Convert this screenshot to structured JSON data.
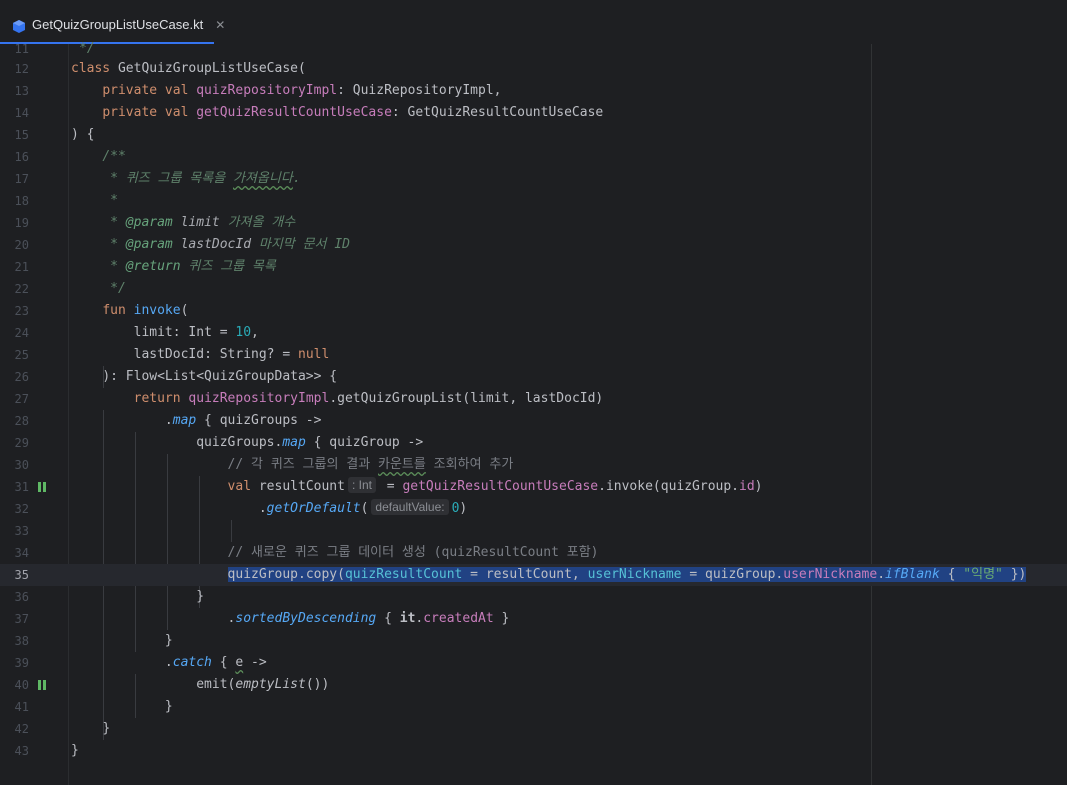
{
  "tab": {
    "filename": "GetQuizGroupListUseCase.kt",
    "icon": "kotlin-file-icon",
    "accent": "#3574f0"
  },
  "editor": {
    "current_line": "35",
    "line_numbers": [
      "11",
      "12",
      "13",
      "14",
      "15",
      "16",
      "17",
      "18",
      "19",
      "20",
      "21",
      "22",
      "23",
      "24",
      "25",
      "26",
      "27",
      "28",
      "29",
      "30",
      "31",
      "32",
      "33",
      "34",
      "35",
      "36",
      "37",
      "38",
      "39",
      "40",
      "41",
      "42",
      "43"
    ],
    "tokens": {
      "l11": "*/",
      "l12_kw": "class",
      "l12_name": "GetQuizGroupListUseCase(",
      "l13_kw": "private val",
      "l13_prop": "quizRepositoryImpl",
      "l13_type": ": QuizRepositoryImpl,",
      "l14_kw": "private val",
      "l14_prop": "getQuizResultCountUseCase",
      "l14_type": ": GetQuizResultCountUseCase",
      "l15": ") {",
      "l16": "/**",
      "l17_star": "* ",
      "l17_text": "퀴즈 그룹 목록을 ",
      "l17_wavy": "가져옵니다",
      "l17_end": ".",
      "l18": "*",
      "l19_star": "* ",
      "l19_tag": "@param",
      "l19_p": "limit",
      "l19_text": "가져올 개수",
      "l20_star": "* ",
      "l20_tag": "@param",
      "l20_p": "lastDocId",
      "l20_text": "마지막 문서 ID",
      "l21_star": "* ",
      "l21_tag": "@return",
      "l21_text": "퀴즈 그룹 목록",
      "l22": "*/",
      "l23_kw": "fun",
      "l23_fn": "invoke",
      "l23_paren": "(",
      "l24_a": "limit: Int = ",
      "l24_num": "10",
      "l24_b": ",",
      "l25_a": "lastDocId: String? = ",
      "l25_kw": "null",
      "l26": "): Flow<List<QuizGroupData>> {",
      "l27_kw": "return",
      "l27_prop": "quizRepositoryImpl",
      "l27_rest": ".getQuizGroupList(limit, lastDocId)",
      "l28_dot": ".",
      "l28_ext": "map",
      "l28_rest": " { quizGroups ->",
      "l29_a": "quizGroups.",
      "l29_ext": "map",
      "l29_rest": " { quizGroup ->",
      "l30_a": "// 각 퀴즈 그룹의 결과 ",
      "l30_wavy": "카운트를",
      "l30_b": " 조회하여 추가",
      "l31_kw": "val",
      "l31_name": "resultCount",
      "l31_hint": ": Int",
      "l31_eq": " = ",
      "l31_prop": "getQuizResultCountUseCase",
      "l31_mid": ".invoke(quizGroup.",
      "l31_prop2": "id",
      "l31_end": ")",
      "l32_dot": ".",
      "l32_ext": "getOrDefault",
      "l32_paren": "(",
      "l32_hint": "defaultValue:",
      "l32_num": "0",
      "l32_end": ")",
      "l34": "// 새로운 퀴즈 그룹 데이터 생성 (quizResultCount 포함)",
      "l35_a": "quizGroup.copy(",
      "l35_named1": "quizResultCount",
      "l35_b": " = resultCount, ",
      "l35_named2": "userNickname",
      "l35_c": " = quizGroup.",
      "l35_prop": "userNickname",
      "l35_dot": ".",
      "l35_ext": "ifBlank",
      "l35_d": " { ",
      "l35_str": "\"익명\"",
      "l35_e": " })",
      "l36": "}",
      "l37_dot": ".",
      "l37_ext": "sortedByDescending",
      "l37_a": " { ",
      "l37_it": "it",
      "l37_dot2": ".",
      "l37_prop": "createdAt",
      "l37_b": " }",
      "l38": "}",
      "l39_dot": ".",
      "l39_fn": "catch",
      "l39_a": " { ",
      "l39_e": "e",
      "l39_b": " ->",
      "l40_a": "emit(",
      "l40_it": "emptyList",
      "l40_b": "())",
      "l41": "}",
      "l42": "}",
      "l43": "}"
    }
  }
}
